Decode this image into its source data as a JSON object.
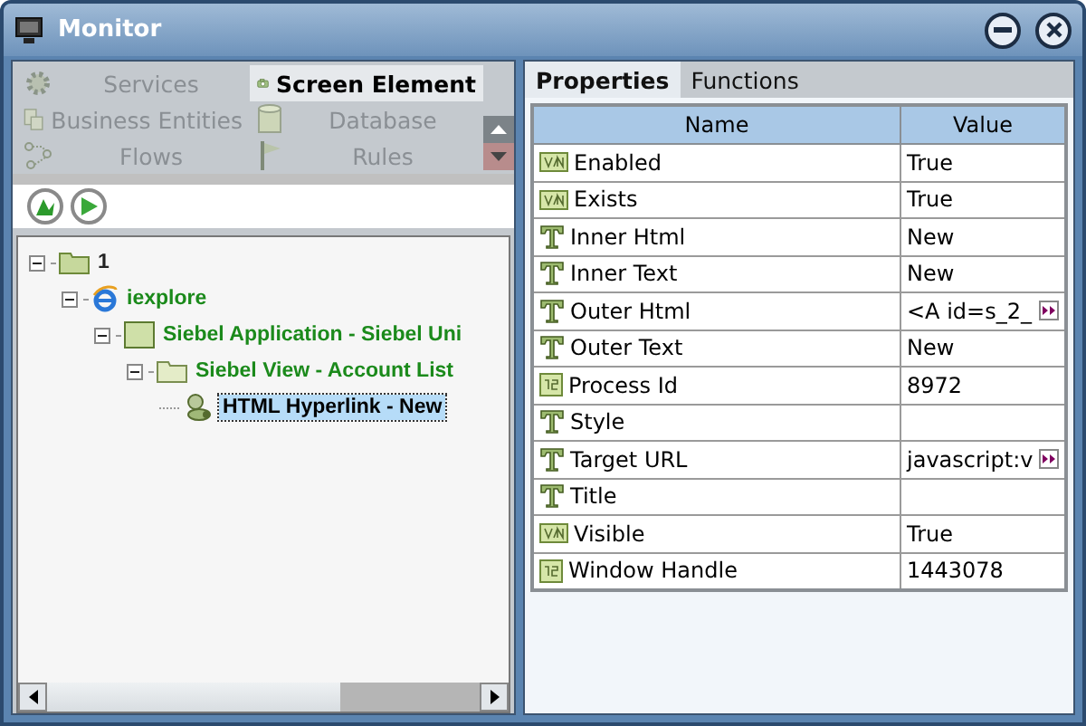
{
  "window": {
    "title": "Monitor"
  },
  "categories": [
    {
      "label": "Services",
      "selected": false
    },
    {
      "label": "Screen Element",
      "selected": true
    },
    {
      "label": "Business Entities",
      "selected": false
    },
    {
      "label": "Database",
      "selected": false
    },
    {
      "label": "Flows",
      "selected": false
    },
    {
      "label": "Rules",
      "selected": false
    }
  ],
  "tree": [
    {
      "label": "1",
      "kind": "folder",
      "expanded": true,
      "selected": false,
      "children": [
        {
          "label": "iexplore",
          "kind": "browser",
          "expanded": true,
          "selected": false,
          "children": [
            {
              "label": "Siebel Application - Siebel Uni",
              "kind": "application",
              "expanded": true,
              "selected": false,
              "children": [
                {
                  "label": "Siebel View - Account List",
                  "kind": "view",
                  "expanded": true,
                  "selected": false,
                  "children": [
                    {
                      "label": "HTML Hyperlink - New",
                      "kind": "element",
                      "selected": true
                    }
                  ]
                }
              ]
            }
          ]
        }
      ]
    }
  ],
  "tabs": [
    {
      "label": "Properties",
      "selected": true
    },
    {
      "label": "Functions",
      "selected": false
    }
  ],
  "table": {
    "columns": [
      "Name",
      "Value"
    ],
    "rows": [
      {
        "kind": "boolean",
        "name": "Enabled",
        "value": "True",
        "expandable": false
      },
      {
        "kind": "boolean",
        "name": "Exists",
        "value": "True",
        "expandable": false
      },
      {
        "kind": "text",
        "name": "Inner Html",
        "value": "New",
        "expandable": false
      },
      {
        "kind": "text",
        "name": "Inner Text",
        "value": "New",
        "expandable": false
      },
      {
        "kind": "text",
        "name": "Outer Html",
        "value": "<A id=s_2_",
        "expandable": true
      },
      {
        "kind": "text",
        "name": "Outer Text",
        "value": "New",
        "expandable": false
      },
      {
        "kind": "number",
        "name": "Process Id",
        "value": "8972",
        "expandable": false
      },
      {
        "kind": "text",
        "name": "Style",
        "value": "",
        "expandable": false
      },
      {
        "kind": "text",
        "name": "Target URL",
        "value": "javascript:v",
        "expandable": true
      },
      {
        "kind": "text",
        "name": "Title",
        "value": "",
        "expandable": false
      },
      {
        "kind": "boolean",
        "name": "Visible",
        "value": "True",
        "expandable": false
      },
      {
        "kind": "number",
        "name": "Window Handle",
        "value": "1443078",
        "expandable": false
      }
    ]
  }
}
